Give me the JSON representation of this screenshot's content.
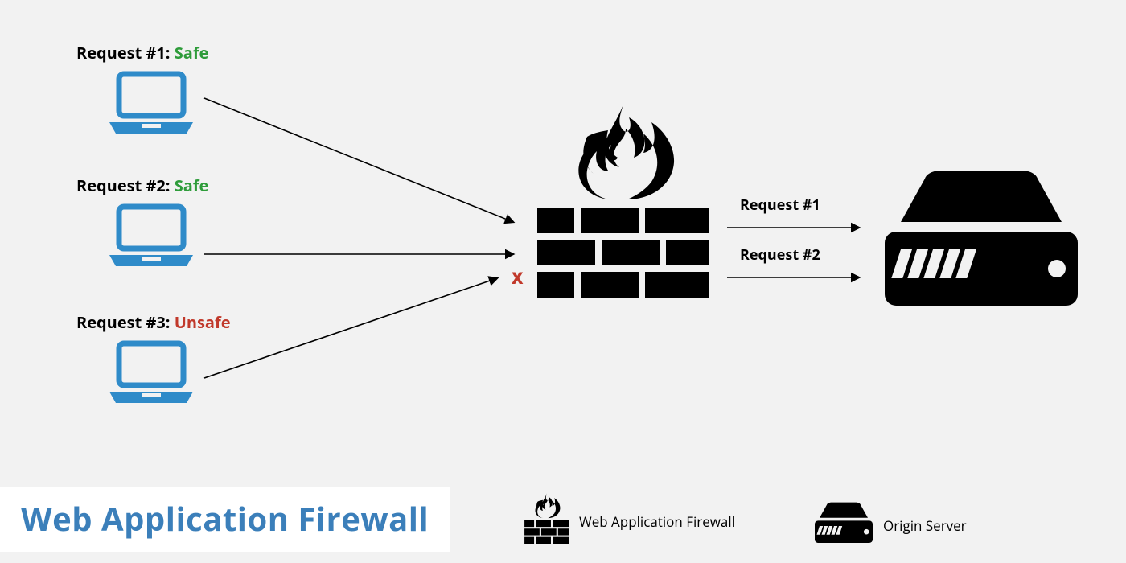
{
  "title": "Web Application Firewall",
  "requests": {
    "r1": {
      "prefix": "Request #1: ",
      "status": "Safe",
      "status_class": "safe"
    },
    "r2": {
      "prefix": "Request #2: ",
      "status": "Safe",
      "status_class": "safe"
    },
    "r3": {
      "prefix": "Request #3: ",
      "status": "Unsafe",
      "status_class": "unsafe"
    }
  },
  "blocked_marker": "X",
  "passes": {
    "p1": "Request #1",
    "p2": "Request #2"
  },
  "legend": {
    "waf": "Web Application Firewall",
    "origin": "Origin Server"
  },
  "colors": {
    "laptop": "#2f8bc9",
    "icon": "#000000",
    "title": "#3b7fba",
    "safe": "#2e9c3a",
    "unsafe": "#c1392b"
  }
}
